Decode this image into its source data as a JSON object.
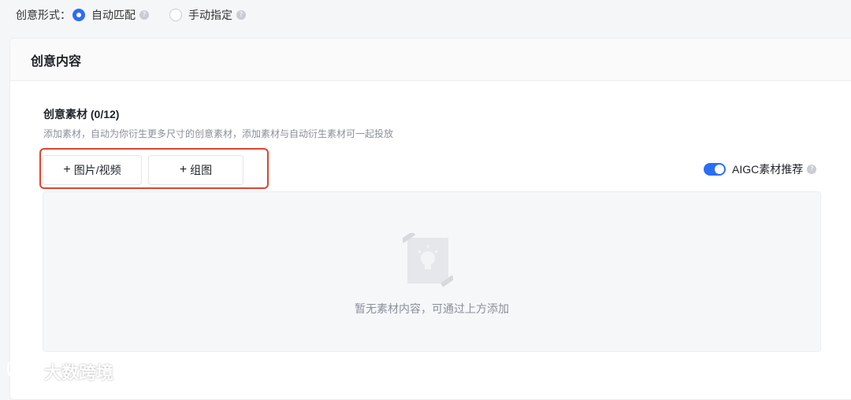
{
  "creative_form": {
    "label": "创意形式：",
    "options": [
      {
        "label": "自动匹配",
        "selected": true
      },
      {
        "label": "手动指定",
        "selected": false
      }
    ],
    "help_glyph": "?"
  },
  "card": {
    "title": "创意内容",
    "materials": {
      "title": "创意素材 (0/12)",
      "description": "添加素材，自动为你衍生更多尺寸的创意素材，添加素材与自动衍生素材可一起投放",
      "buttons": [
        {
          "plus": "+",
          "label": "图片/视频"
        },
        {
          "plus": "+",
          "label": "组图"
        }
      ],
      "aigc": {
        "label": "AIGC素材推荐",
        "enabled": true
      },
      "empty_text": "暂无素材内容，可通过上方添加"
    }
  },
  "watermark": {
    "text": "大数跨境"
  },
  "colors": {
    "accent": "#2b6ef6",
    "highlight": "#e0442f"
  }
}
